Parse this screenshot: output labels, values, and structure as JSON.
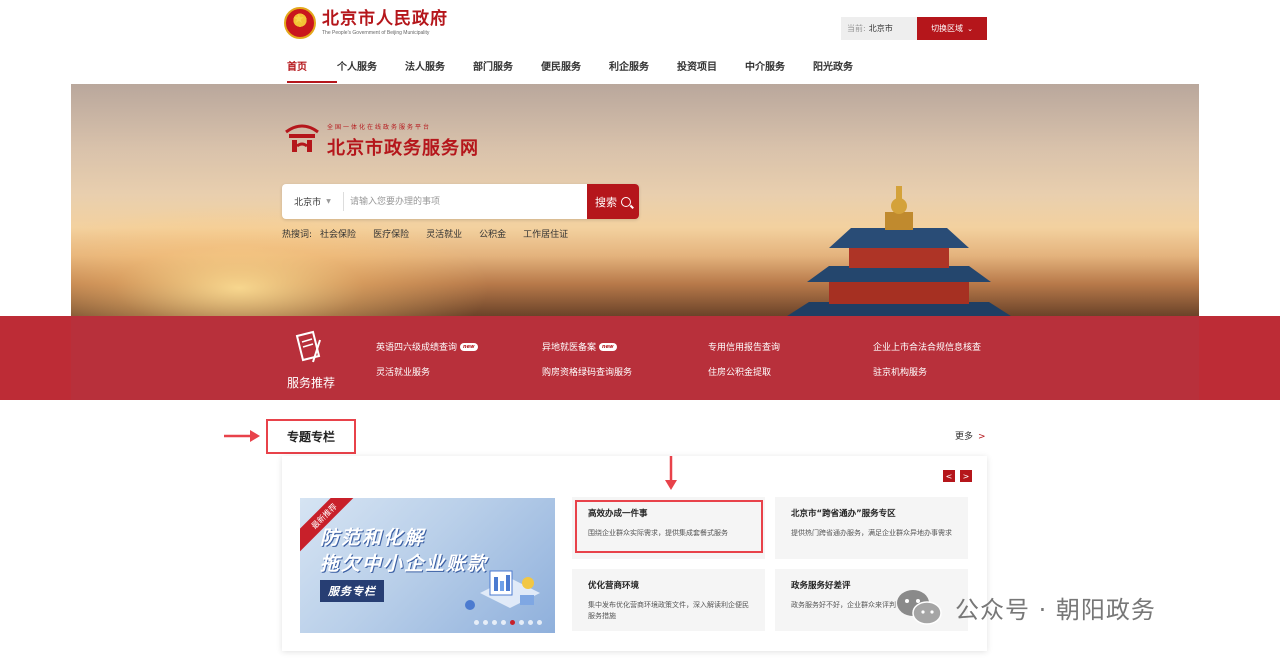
{
  "header": {
    "logo_cn": "北京市人民政府",
    "logo_en": "The People's Government of Beijing Municipality",
    "region_label": "当前:",
    "region_value": "北京市",
    "region_switch": "切换区域"
  },
  "nav": {
    "items": [
      "首页",
      "个人服务",
      "法人服务",
      "部门服务",
      "便民服务",
      "利企服务",
      "投资项目",
      "中介服务",
      "阳光政务"
    ]
  },
  "banner": {
    "subtitle": "全国一体化在线政务服务平台",
    "title": "北京市政务服务网",
    "search_region": "北京市",
    "search_placeholder": "请输入您要办理的事项",
    "search_button": "搜索",
    "hot_label": "热搜词:",
    "hot_words": [
      "社会保险",
      "医疗保险",
      "灵活就业",
      "公积金",
      "工作居住证"
    ]
  },
  "recommend": {
    "label": "服务推荐",
    "items": [
      "英语四六级成绩查询",
      "异地就医备案",
      "专用信用报告查询",
      "企业上市合法合规信息核查",
      "灵活就业服务",
      "购房资格绿码查询服务",
      "住房公积金提取",
      "驻京机构服务"
    ],
    "new_badge": "new"
  },
  "topic": {
    "title": "专题专栏",
    "more": "更多",
    "more_arrow": ">",
    "pager_prev": "<",
    "pager_next": ">",
    "feature": {
      "ribbon": "最新推荐",
      "line1": "防范和化解",
      "line2": "拖欠中小企业账款",
      "tag": "服务专栏",
      "active_dot_index": 4
    },
    "cards": [
      {
        "title": "高效办成一件事",
        "desc": "围绕企业群众实际需求，提供集成套餐式服务"
      },
      {
        "title": "北京市“跨省通办”服务专区",
        "desc": "提供热门跨省通办服务，满足企业群众异地办事需求"
      },
      {
        "title": "优化营商环境",
        "desc": "集中发布优化营商环境政策文件，深入解读利企便民服务措施"
      },
      {
        "title": "政务服务好差评",
        "desc": "政务服务好不好，企业群众来评判"
      }
    ]
  },
  "watermark": "公众号 · 朝阳政务",
  "colors": {
    "brand_red": "#b5161b",
    "rec_bar": "#b8303b",
    "highlight": "#e8424a"
  }
}
